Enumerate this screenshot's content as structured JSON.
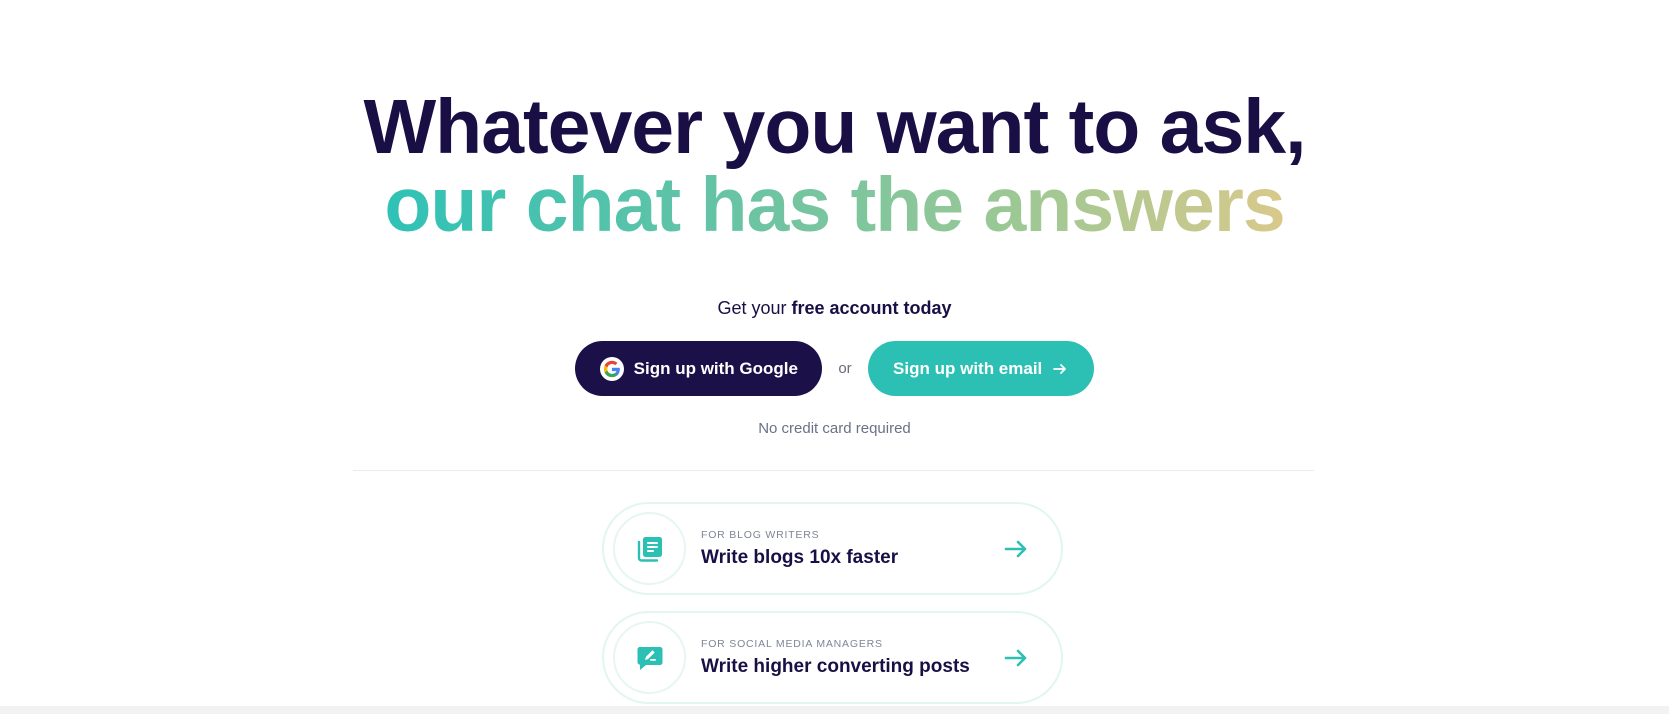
{
  "hero": {
    "headline_line1": "Whatever you want to ask,",
    "headline_line2": "our chat has the answers"
  },
  "cta": {
    "lead_prefix": "Get your ",
    "lead_bold": "free account today",
    "google_button_label": "Sign up with Google",
    "or_text": "or",
    "email_button_label": "Sign up with email",
    "note": "No credit card required"
  },
  "cards": [
    {
      "kicker": "FOR BLOG WRITERS",
      "title": "Write blogs 10x faster",
      "icon": "document-icon"
    },
    {
      "kicker": "FOR SOCIAL MEDIA MANAGERS",
      "title": "Write higher converting posts",
      "icon": "edit-message-icon"
    }
  ],
  "colors": {
    "navy": "#190f45",
    "button_dark": "#1c1049",
    "teal": "#2cbfb3",
    "gradient_start": "#2fc2b6",
    "gradient_end": "#d9c98b"
  }
}
